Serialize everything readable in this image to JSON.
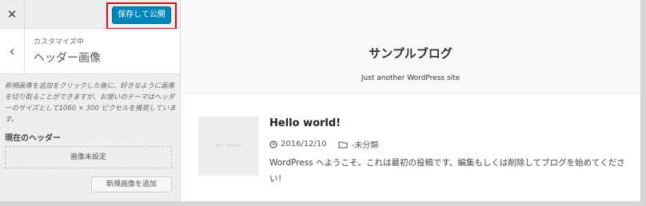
{
  "topbar": {
    "close_symbol": "✕",
    "save_label": "保存して公開",
    "highlight_color": "#e30613",
    "save_color": "#0085ba"
  },
  "section": {
    "back_symbol": "‹",
    "subtitle": "カスタマイズ中",
    "title": "ヘッダー画像"
  },
  "description": "新規画像を追加をクリックした後に、好きなように画像を切り取ることができますが、お使いのテーマはヘッダーのサイズとして1060 × 300 ピクセルを推奨しています。",
  "current_header": {
    "label": "現在のヘッダー",
    "no_image_text": "画像未設定",
    "add_new_label": "新規画像を追加"
  },
  "preview": {
    "site_title": "サンプルブログ",
    "tagline": "Just another WordPress site",
    "thumbnail_text": "NO IMAGE",
    "post": {
      "title": "Hello world!",
      "date_icon": "clock-icon",
      "date": "2016/12/10",
      "category_icon": "folder-icon",
      "category": "-未分類",
      "excerpt": "WordPress へようこそ。これは最初の投稿です。編集もしくは削除してブログを始めてください！"
    }
  }
}
